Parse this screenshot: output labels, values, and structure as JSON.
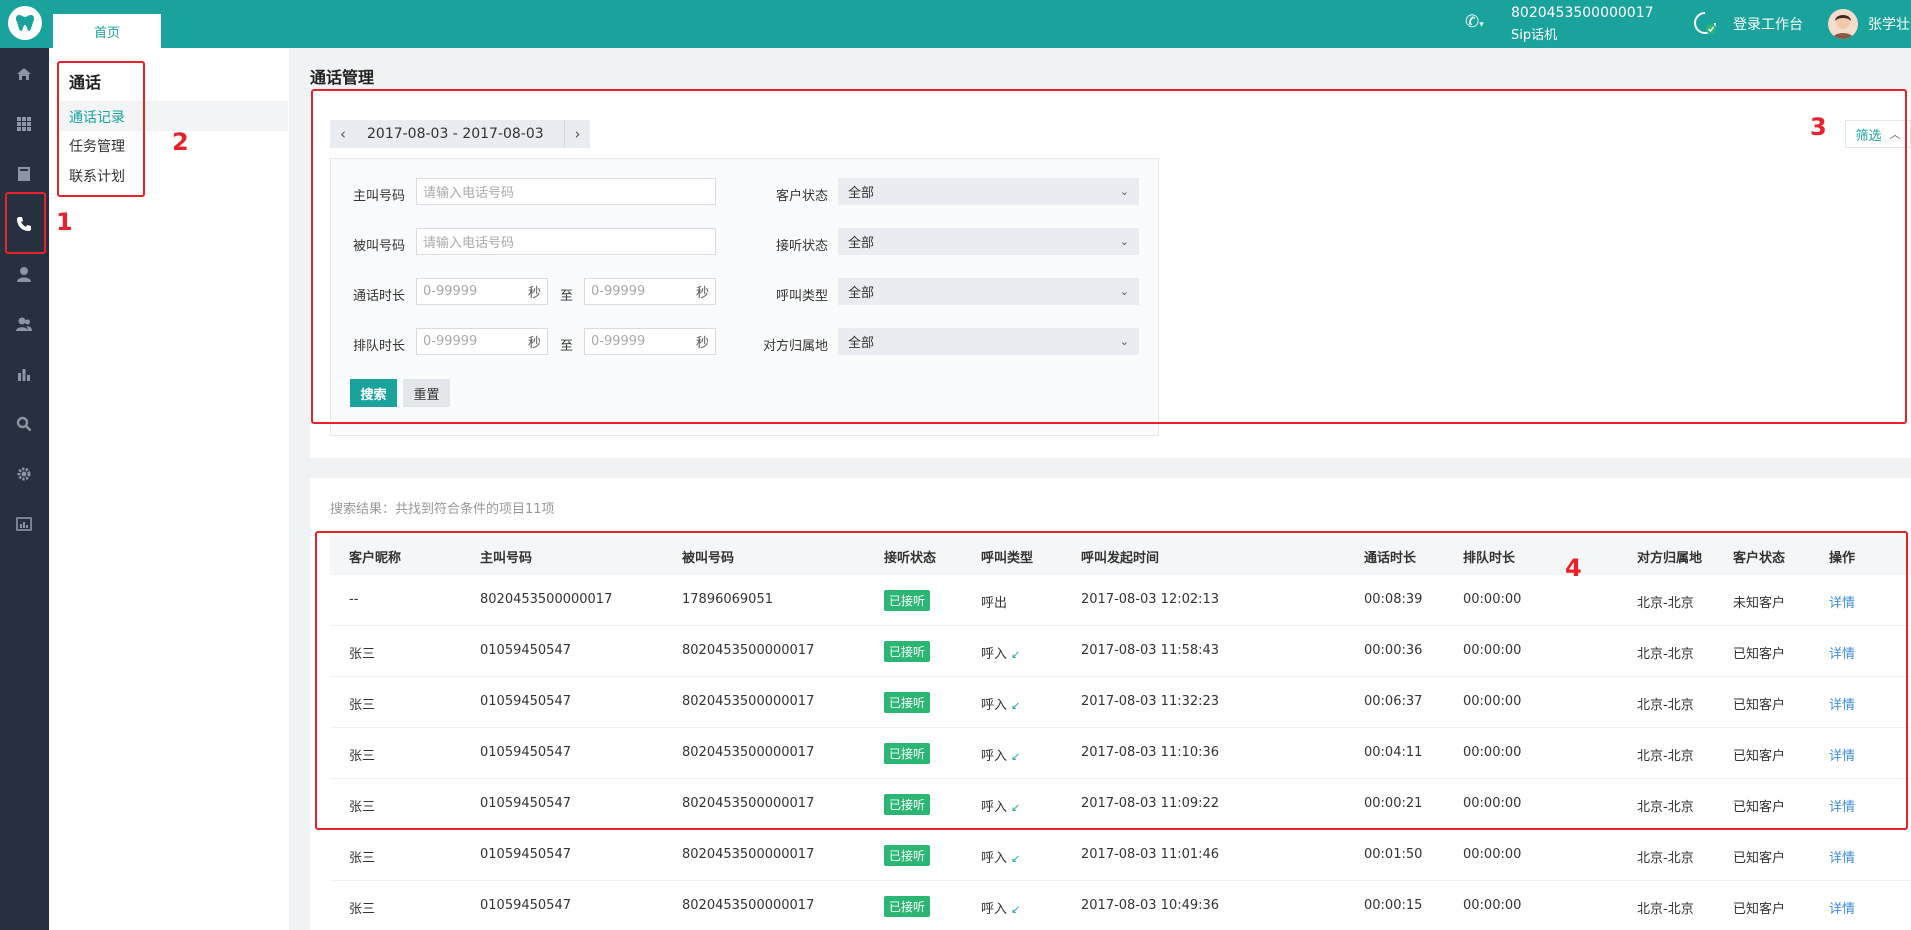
{
  "topbar": {
    "home_tab": "首页",
    "sip_number": "8020453500000017",
    "sip_label": "Sip话机",
    "workbench_label": "登录工作台",
    "user_name": "张学壮"
  },
  "sidebar": {
    "icons": [
      "home-icon",
      "apps-grid-icon",
      "book-icon",
      "phone-icon",
      "user-icon",
      "users-icon",
      "bar-chart-icon",
      "search-icon",
      "gear-icon",
      "report-icon"
    ]
  },
  "submenu": {
    "title": "通话",
    "items": [
      "通话记录",
      "任务管理",
      "联系计划"
    ]
  },
  "main": {
    "title": "通话管理",
    "date_range": "2017-08-03 - 2017-08-03",
    "filter_toggle": "筛选",
    "filters": {
      "caller_label": "主叫号码",
      "caller_placeholder": "请输入电话号码",
      "callee_label": "被叫号码",
      "callee_placeholder": "请输入电话号码",
      "duration_label": "通话时长",
      "queue_label": "排队时长",
      "range_placeholder": "0-99999",
      "unit": "秒",
      "to": "至",
      "customer_status_label": "客户状态",
      "answer_status_label": "接听状态",
      "call_type_label": "呼叫类型",
      "region_label": "对方归属地",
      "all_option": "全部"
    },
    "search_button": "搜索",
    "reset_button": "重置",
    "result_summary": "搜索结果：共找到符合条件的项目11项"
  },
  "table": {
    "columns": [
      "客户昵称",
      "主叫号码",
      "被叫号码",
      "接听状态",
      "呼叫类型",
      "呼叫发起时间",
      "通话时长",
      "排队时长",
      "对方归属地",
      "客户状态",
      "操作"
    ],
    "rows": [
      [
        "--",
        "8020453500000017",
        "17896069051",
        "已接听",
        "呼出",
        "2017-08-03 12:02:13",
        "00:08:39",
        "00:00:00",
        "北京-北京",
        "未知客户",
        "详情"
      ],
      [
        "张三",
        "01059450547",
        "8020453500000017",
        "已接听",
        "呼入",
        "2017-08-03 11:58:43",
        "00:00:36",
        "00:00:00",
        "北京-北京",
        "已知客户",
        "详情"
      ],
      [
        "张三",
        "01059450547",
        "8020453500000017",
        "已接听",
        "呼入",
        "2017-08-03 11:32:23",
        "00:06:37",
        "00:00:00",
        "北京-北京",
        "已知客户",
        "详情"
      ],
      [
        "张三",
        "01059450547",
        "8020453500000017",
        "已接听",
        "呼入",
        "2017-08-03 11:10:36",
        "00:04:11",
        "00:00:00",
        "北京-北京",
        "已知客户",
        "详情"
      ],
      [
        "张三",
        "01059450547",
        "8020453500000017",
        "已接听",
        "呼入",
        "2017-08-03 11:09:22",
        "00:00:21",
        "00:00:00",
        "北京-北京",
        "已知客户",
        "详情"
      ],
      [
        "张三",
        "01059450547",
        "8020453500000017",
        "已接听",
        "呼入",
        "2017-08-03 11:01:46",
        "00:01:50",
        "00:00:00",
        "北京-北京",
        "已知客户",
        "详情"
      ],
      [
        "张三",
        "01059450547",
        "8020453500000017",
        "已接听",
        "呼入",
        "2017-08-03 10:49:36",
        "00:00:15",
        "00:00:00",
        "北京-北京",
        "已知客户",
        "详情"
      ]
    ]
  },
  "annotations": [
    "1",
    "2",
    "3",
    "4"
  ],
  "colors": {
    "brand": "#1aa39c",
    "sidebar": "#26313f",
    "badge": "#2bb673",
    "link": "#3c8ee0",
    "annotation": "#e8212a"
  }
}
